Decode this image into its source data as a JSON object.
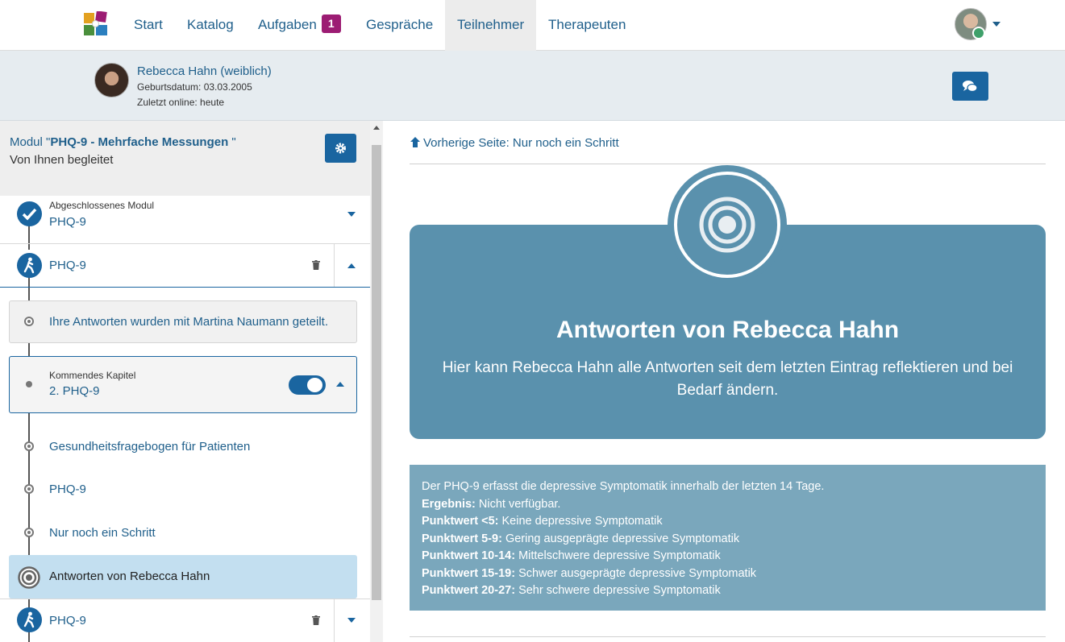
{
  "nav": {
    "items": [
      "Start",
      "Katalog",
      "Aufgaben",
      "Gespräche",
      "Teilnehmer",
      "Therapeuten"
    ],
    "tasks_badge": "1",
    "active": "Teilnehmer"
  },
  "participant": {
    "name": "Rebecca Hahn (weiblich)",
    "birth": "Geburtsdatum: 03.03.2005",
    "last_online": "Zuletzt online: heute"
  },
  "module": {
    "prefix": "Modul \"",
    "name": "PHQ-9 - Mehrfache Messungen",
    "suffix": "\"",
    "subtitle": "Von Ihnen begleitet"
  },
  "timeline": {
    "completed_label": "Abgeschlossenes Modul",
    "completed_name": "PHQ-9",
    "current_name": "PHQ-9",
    "shared_info": "Ihre Antworten wurden mit Martina Naumann geteilt.",
    "upcoming_label": "Kommendes Kapitel",
    "upcoming_name": "2. PHQ-9",
    "steps": [
      "Gesundheitsfragebogen für Patienten",
      "PHQ-9",
      "Nur noch ein Schritt",
      "Antworten von Rebecca Hahn"
    ],
    "next_name": "PHQ-9"
  },
  "content": {
    "back_link": "Vorherige Seite: Nur noch ein Schritt",
    "hero_title": "Antworten von Rebecca Hahn",
    "hero_text": "Hier kann Rebecca Hahn alle Antworten seit dem letzten Eintrag reflektieren und bei Bedarf ändern.",
    "intro": "Der PHQ-9 erfasst die depressive Symptomatik innerhalb der letzten 14 Tage.",
    "lines": [
      {
        "label": "Ergebnis:",
        "text": " Nicht verfügbar."
      },
      {
        "label": "Punktwert <5:",
        "text": " Keine depressive Symptomatik"
      },
      {
        "label": "Punktwert 5-9:",
        "text": " Gering ausgeprägte depressive Symptomatik"
      },
      {
        "label": "Punktwert 10-14:",
        "text": " Mittelschwere depressive Symptomatik"
      },
      {
        "label": "Punktwert 15-19:",
        "text": " Schwer ausgeprägte depressive Symptomatik"
      },
      {
        "label": "Punktwert 20-27:",
        "text": " Sehr schwere depressive Symptomatik"
      }
    ]
  },
  "colors": {
    "primary": "#1a65a0",
    "hero": "#5a91ad",
    "desc": "#7aa7bc",
    "badge": "#9c1c73",
    "active_step": "#c3dff0"
  }
}
